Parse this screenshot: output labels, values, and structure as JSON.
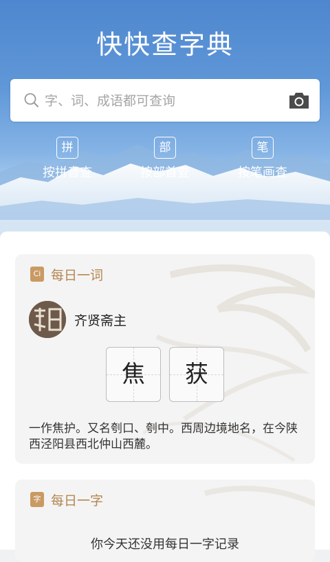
{
  "app": {
    "title": "快快查字典"
  },
  "search": {
    "placeholder": "字、词、成语都可查询"
  },
  "modes": [
    {
      "badge": "拼",
      "label": "按拼音查"
    },
    {
      "badge": "部",
      "label": "按部首查"
    },
    {
      "badge": "笔",
      "label": "按笔画查"
    }
  ],
  "daily_word": {
    "heading": "每日一词",
    "icon_text": "Ci",
    "author": "齐贤斋主",
    "chars": [
      "焦",
      "获"
    ],
    "description": "一作焦护。又名刳口、刳中。西周边境地名，在今陕西泾阳县西北仲山西麓。"
  },
  "daily_char": {
    "heading": "每日一字",
    "icon_text": "字",
    "empty_text": "你今天还没用每日一字记录"
  },
  "colors": {
    "accent": "#b48650",
    "hero": "#4f87cf"
  }
}
